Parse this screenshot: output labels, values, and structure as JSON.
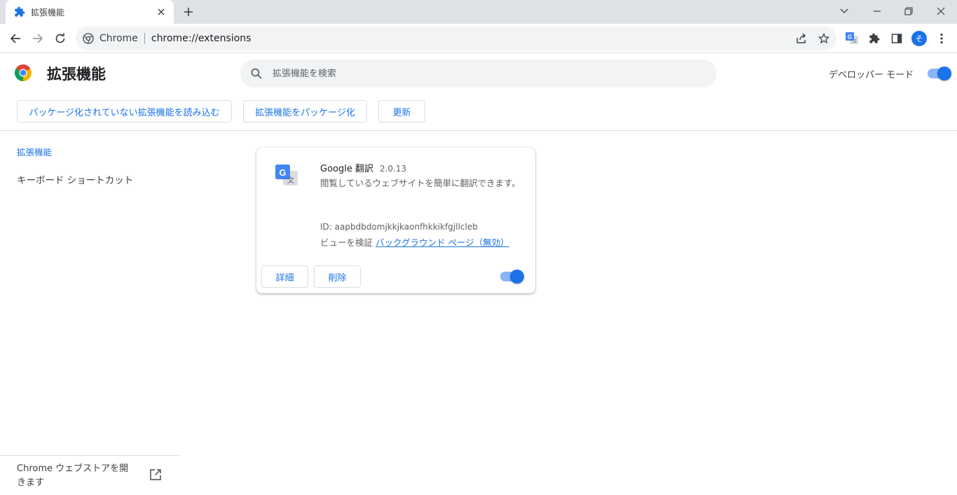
{
  "tab": {
    "title": "拡張機能"
  },
  "toolbar": {
    "site_name": "Chrome",
    "url": "chrome://extensions",
    "avatar_letter": "そ"
  },
  "header": {
    "title": "拡張機能",
    "search_placeholder": "拡張機能を検索",
    "developer_mode_label": "デベロッパー モード",
    "developer_mode_on": true
  },
  "actions": {
    "load_unpacked": "パッケージ化されていない拡張機能を読み込む",
    "pack": "拡張機能をパッケージ化",
    "update": "更新"
  },
  "sidebar": {
    "extensions": "拡張機能",
    "shortcuts": "キーボード ショートカット",
    "store_link": "Chrome ウェブストアを開きます"
  },
  "extension": {
    "name": "Google 翻訳",
    "version": "2.0.13",
    "description": "閲覧しているウェブサイトを簡単に翻訳できます。",
    "id": "ID: aapbdbdomjkkjkaonfhkkikfgjllcleb",
    "views_label": "ビューを検証",
    "views_link": "バックグラウンド ページ（無効）",
    "details_button": "詳細",
    "remove_button": "削除",
    "enabled": true
  },
  "colors": {
    "accent": "#1a73e8",
    "toggle_track": "#8ab4f8"
  }
}
